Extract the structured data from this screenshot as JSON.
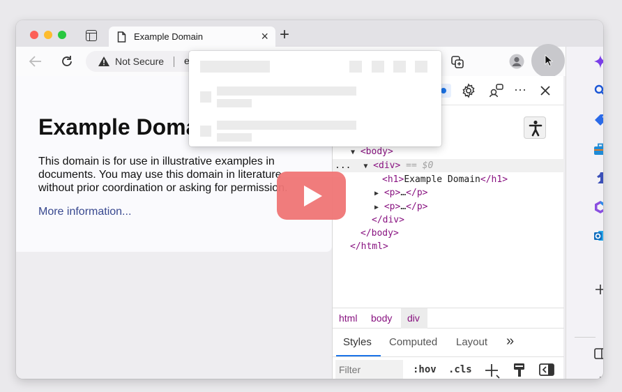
{
  "tab": {
    "title": "Example Domain",
    "close": "×",
    "new_tab": "+"
  },
  "address_bar": {
    "security_label": "Not Secure",
    "url_visible": "e"
  },
  "page": {
    "heading": "Example Domain",
    "paragraph": "This domain is for use in illustrative examples in documents. You may use this domain in literature without prior coordination or asking for permission.",
    "link": "More information..."
  },
  "devtools": {
    "dom": {
      "body_open": "<body>",
      "div_open": "<div>",
      "selected_marker": "== $0",
      "ellipsis": "...",
      "h1_open": "<h1>",
      "h1_text": "Example Domain",
      "h1_close": "</h1>",
      "p_open": "<p>",
      "p_ellipsis": "…",
      "p_close": "</p>",
      "div_close": "</div>",
      "body_close": "</body>",
      "html_close": "</html>"
    },
    "breadcrumbs": [
      "html",
      "body",
      "div"
    ],
    "panel_tabs": [
      "Styles",
      "Computed",
      "Layout",
      "»"
    ],
    "filter_placeholder": "Filter",
    "hov_label": ":hov",
    "cls_label": ".cls",
    "more_dots": "···"
  },
  "colors": {
    "tag": "#881280",
    "link": "#38488f",
    "play_button": "#f07676",
    "accent_blue": "#1a73e8"
  }
}
